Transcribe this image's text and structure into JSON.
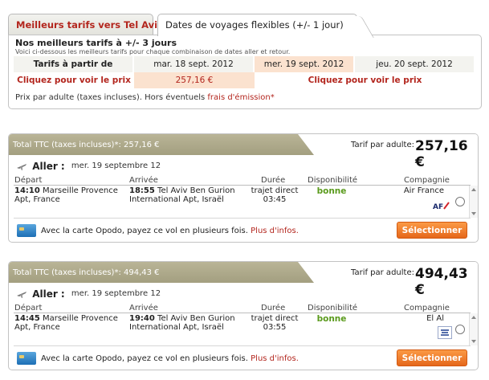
{
  "tabs": [
    {
      "label": "Meilleurs tarifs vers Tel Aviv"
    },
    {
      "label": "Dates de voyages flexibles (+/- 1 jour)"
    }
  ],
  "flex": {
    "title": "Nos meilleurs tarifs à +/- 3 jours",
    "subtitle": "Voici ci-dessous les meilleurs tarifs pour chaque combinaison de dates aller et retour.",
    "row_label": "Tarifs à partir de",
    "dates": [
      "mar. 18 sept. 2012",
      "mer. 19 sept. 2012",
      "jeu. 20 sept. 2012"
    ],
    "prices": [
      "Cliquez pour voir le prix",
      "257,16 €",
      "Cliquez pour voir le prix"
    ],
    "note": "Prix par adulte (taxes incluses). Hors éventuels",
    "note_link": "frais d'émission*"
  },
  "offers": [
    {
      "total": "Total TTC (taxes incluses)*: 257,16 €",
      "tarif_label": "Tarif par adulte:",
      "tarif_value": "257,16 €",
      "aller_label": "Aller :",
      "aller_date": "mer. 19 septembre 12",
      "headers": {
        "depart": "Départ",
        "arrivee": "Arrivée",
        "duree": "Durée",
        "dispo": "Disponibilité",
        "compagnie": "Compagnie"
      },
      "dep_time": "14:10",
      "dep_place": "Marseille Provence Apt, France",
      "arr_time": "18:55",
      "arr_place": "Tel Aviv Ben Gurion International Apt, Israël",
      "duration_type": "trajet direct",
      "duration": "03:45",
      "dispo": "bonne",
      "airline": "Air France",
      "airline_logo": "air-france-logo",
      "cc_text": "Avec la carte Opodo, payez ce vol en plusieurs fois.",
      "cc_link": "Plus d'infos.",
      "button": "Sélectionner"
    },
    {
      "total": "Total TTC (taxes incluses)*: 494,43 €",
      "tarif_label": "Tarif par adulte:",
      "tarif_value": "494,43 €",
      "aller_label": "Aller :",
      "aller_date": "mer. 19 septembre 12",
      "headers": {
        "depart": "Départ",
        "arrivee": "Arrivée",
        "duree": "Durée",
        "dispo": "Disponibilité",
        "compagnie": "Compagnie"
      },
      "dep_time": "14:45",
      "dep_place": "Marseille Provence Apt, France",
      "arr_time": "19:40",
      "arr_place": "Tel Aviv Ben Gurion International Apt, Israël",
      "duration_type": "trajet direct",
      "duration": "03:55",
      "dispo": "bonne",
      "airline": "El Al",
      "airline_logo": "el-al-logo",
      "cc_text": "Avec la carte Opodo, payez ce vol en plusieurs fois.",
      "cc_link": "Plus d'infos.",
      "button": "Sélectionner"
    }
  ]
}
